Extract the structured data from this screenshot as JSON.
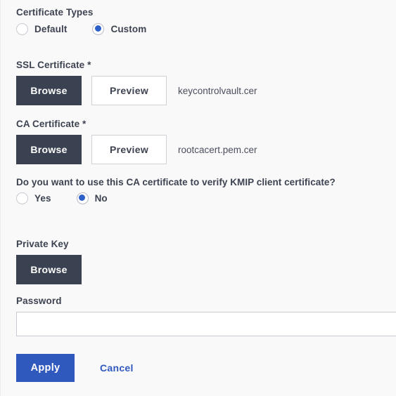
{
  "form": {
    "certificate_types": {
      "label": "Certificate Types",
      "options": [
        {
          "label": "Default",
          "selected": false
        },
        {
          "label": "Custom",
          "selected": true
        }
      ]
    },
    "ssl_certificate": {
      "label": "SSL Certificate",
      "required_marker": "*",
      "browse_label": "Browse",
      "preview_label": "Preview",
      "file_name": "keycontrolvault.cer"
    },
    "ca_certificate": {
      "label": "CA Certificate",
      "required_marker": "*",
      "browse_label": "Browse",
      "preview_label": "Preview",
      "file_name": "rootcacert.pem.cer"
    },
    "kmip_verify": {
      "question": "Do you want to use this CA certificate to verify KMIP client certificate?",
      "options": [
        {
          "label": "Yes",
          "selected": false
        },
        {
          "label": "No",
          "selected": true
        }
      ]
    },
    "private_key": {
      "label": "Private Key",
      "browse_label": "Browse"
    },
    "password": {
      "label": "Password",
      "value": "",
      "placeholder": ""
    },
    "actions": {
      "apply_label": "Apply",
      "cancel_label": "Cancel"
    }
  },
  "colors": {
    "page_background": "#f9f9fa",
    "primary_blue": "#3059bd",
    "radio_blue": "#2c5fc8",
    "dark_button": "#3a4150",
    "text": "#3d4350",
    "border": "#c9cbd2"
  }
}
